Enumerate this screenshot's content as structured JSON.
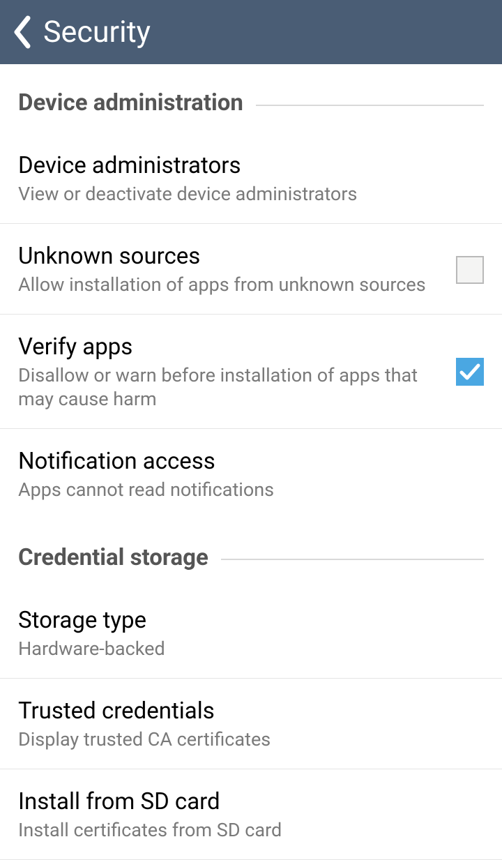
{
  "header": {
    "title": "Security"
  },
  "sections": {
    "device_admin": {
      "title": "Device administration",
      "items": {
        "device_administrators": {
          "title": "Device administrators",
          "sub": "View or deactivate device administrators"
        },
        "unknown_sources": {
          "title": "Unknown sources",
          "sub": "Allow installation of apps from unknown sources",
          "checked": false
        },
        "verify_apps": {
          "title": "Verify apps",
          "sub": "Disallow or warn before installation of apps that may cause harm",
          "checked": true
        },
        "notification_access": {
          "title": "Notification access",
          "sub": "Apps cannot read notifications"
        }
      }
    },
    "credential_storage": {
      "title": "Credential storage",
      "items": {
        "storage_type": {
          "title": "Storage type",
          "sub": "Hardware-backed"
        },
        "trusted_credentials": {
          "title": "Trusted credentials",
          "sub": "Display trusted CA certificates"
        },
        "install_from_sd": {
          "title": "Install from SD card",
          "sub": "Install certificates from SD card"
        }
      }
    }
  }
}
